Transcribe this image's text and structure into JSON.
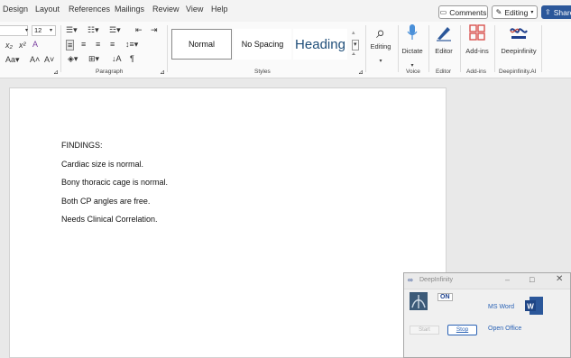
{
  "tabs": [
    "Design",
    "Layout",
    "References",
    "Mailings",
    "Review",
    "View",
    "Help"
  ],
  "top_buttons": {
    "comments": "Comments",
    "editing": "Editing",
    "share": "Share"
  },
  "font": {
    "size": "12"
  },
  "groups": {
    "paragraph": "Paragraph",
    "styles": "Styles",
    "voice": "Voice",
    "editor": "Editor",
    "addins": "Add-ins",
    "deepinfinity": "Deepinfinity.AI"
  },
  "styles": {
    "normal": "Normal",
    "nospacing": "No Spacing",
    "heading": "Heading"
  },
  "buttons": {
    "editing": "Editing",
    "dictate": "Dictate",
    "editor": "Editor",
    "addins": "Add-ins",
    "deepinfinity": "Deepinfinity"
  },
  "document": {
    "lines": [
      "FINDINGS:",
      "Cardiac size is normal.",
      "Bony thoracic cage is normal.",
      "Both CP angles are free.",
      "Needs Clinical Correlation."
    ]
  },
  "panel": {
    "title": "DeepInfinity",
    "status": "ON",
    "app": "MS Word",
    "start": "Start",
    "stop": "Stop",
    "open_office": "Open Office"
  },
  "colors": {
    "accent": "#2b579a",
    "heading": "#1f4e79",
    "link": "#2a62b5",
    "status_on": "#1a3e8c"
  }
}
